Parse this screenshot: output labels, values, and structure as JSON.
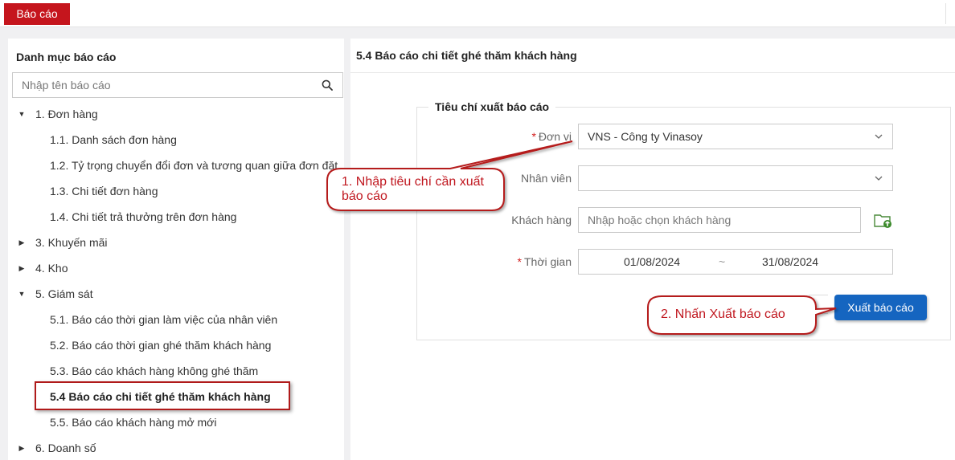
{
  "topbar": {
    "active_tab": "Báo cáo"
  },
  "sidebar": {
    "title": "Danh mục báo cáo",
    "search_placeholder": "Nhập tên báo cáo",
    "items": [
      {
        "label": "1. Đơn hàng",
        "level": 0,
        "expanded": true
      },
      {
        "label": "1.1. Danh sách đơn hàng",
        "level": 1
      },
      {
        "label": "1.2. Tỷ trọng chuyển đổi đơn và tương quan giữa đơn đặt",
        "level": 1
      },
      {
        "label": "1.3. Chi tiết đơn hàng",
        "level": 1
      },
      {
        "label": "1.4. Chi tiết trả thưởng trên đơn hàng",
        "level": 1
      },
      {
        "label": "3. Khuyến mãi",
        "level": 0,
        "expanded": false
      },
      {
        "label": "4. Kho",
        "level": 0,
        "expanded": false
      },
      {
        "label": "5. Giám sát",
        "level": 0,
        "expanded": true
      },
      {
        "label": "5.1. Báo cáo thời gian làm việc của nhân viên",
        "level": 1
      },
      {
        "label": "5.2. Báo cáo thời gian ghé thăm khách hàng",
        "level": 1
      },
      {
        "label": "5.3. Báo cáo khách hàng không ghé thăm",
        "level": 1
      },
      {
        "label": "5.4 Báo cáo chi tiết ghé thăm khách hàng",
        "level": 1,
        "selected": true
      },
      {
        "label": "5.5. Báo cáo khách hàng mở mới",
        "level": 1
      },
      {
        "label": "6. Doanh số",
        "level": 0,
        "expanded": false
      }
    ]
  },
  "main": {
    "title": "5.4 Báo cáo chi tiết ghé thăm khách hàng",
    "criteria_title": "Tiêu chí xuất báo cáo",
    "fields": {
      "unit": {
        "label": "Đơn vị",
        "required": "*",
        "value": "VNS - Công ty Vinasoy"
      },
      "staff": {
        "label": "Nhân viên",
        "value": ""
      },
      "customer": {
        "label": "Khách hàng",
        "placeholder": "Nhập hoặc chọn khách hàng"
      },
      "time": {
        "label": "Thời gian",
        "required": "*",
        "from": "01/08/2024",
        "separator": "~",
        "to": "31/08/2024"
      }
    },
    "export_button": "Xuất báo cáo"
  },
  "callouts": {
    "step1_line1": "1. Nhập tiêu chí cần xuất",
    "step1_line2": "báo cáo",
    "step2": "2. Nhấn Xuất báo cáo"
  },
  "colors": {
    "brand_red": "#c5151d",
    "primary_blue": "#1565c0",
    "callout_red": "#c0171f"
  },
  "icons": [
    "search-icon",
    "chevron-down-icon",
    "caret-down-icon",
    "caret-right-icon",
    "folder-add-icon"
  ]
}
